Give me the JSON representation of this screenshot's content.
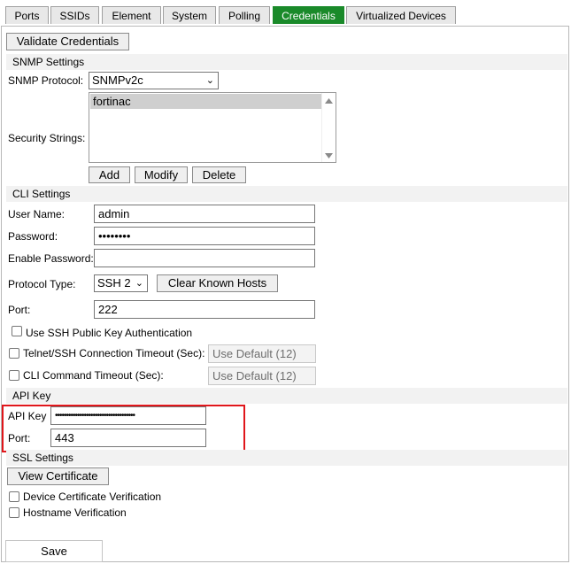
{
  "tabs": [
    {
      "label": "Ports"
    },
    {
      "label": "SSIDs"
    },
    {
      "label": "Element"
    },
    {
      "label": "System"
    },
    {
      "label": "Polling"
    },
    {
      "label": "Credentials",
      "active": true
    },
    {
      "label": "Virtualized Devices"
    }
  ],
  "validate_button": "Validate Credentials",
  "snmp": {
    "section_title": "SNMP Settings",
    "protocol_label": "SNMP Protocol:",
    "protocol_value": "SNMPv2c",
    "security_label": "Security Strings:",
    "security_items": [
      "fortinac"
    ],
    "add_button": "Add",
    "modify_button": "Modify",
    "delete_button": "Delete"
  },
  "cli": {
    "section_title": "CLI Settings",
    "username_label": "User Name:",
    "username_value": "admin",
    "password_label": "Password:",
    "password_value": "••••••••",
    "enable_password_label": "Enable Password:",
    "enable_password_value": "",
    "protocol_type_label": "Protocol Type:",
    "protocol_type_value": "SSH 2",
    "clear_hosts_button": "Clear Known Hosts",
    "port_label": "Port:",
    "port_value": "222",
    "ssh_key_label": "Use SSH Public Key Authentication",
    "telnet_timeout_label": "Telnet/SSH Connection Timeout (Sec):",
    "telnet_timeout_value": "Use Default (12)",
    "cli_timeout_label": "CLI Command Timeout (Sec):",
    "cli_timeout_value": "Use Default (12)"
  },
  "api": {
    "section_title": "API Key",
    "key_label": "API Key",
    "key_value": "••••••••••••••••••••••••••••••••••••",
    "port_label": "Port:",
    "port_value": "443",
    "highlight_color": "#e0161b"
  },
  "ssl": {
    "section_title": "SSL Settings",
    "view_cert_button": "View Certificate",
    "device_cert_label": "Device Certificate Verification",
    "hostname_label": "Hostname Verification"
  },
  "save_button": "Save",
  "colors": {
    "active_tab": "#1a8a2a"
  }
}
